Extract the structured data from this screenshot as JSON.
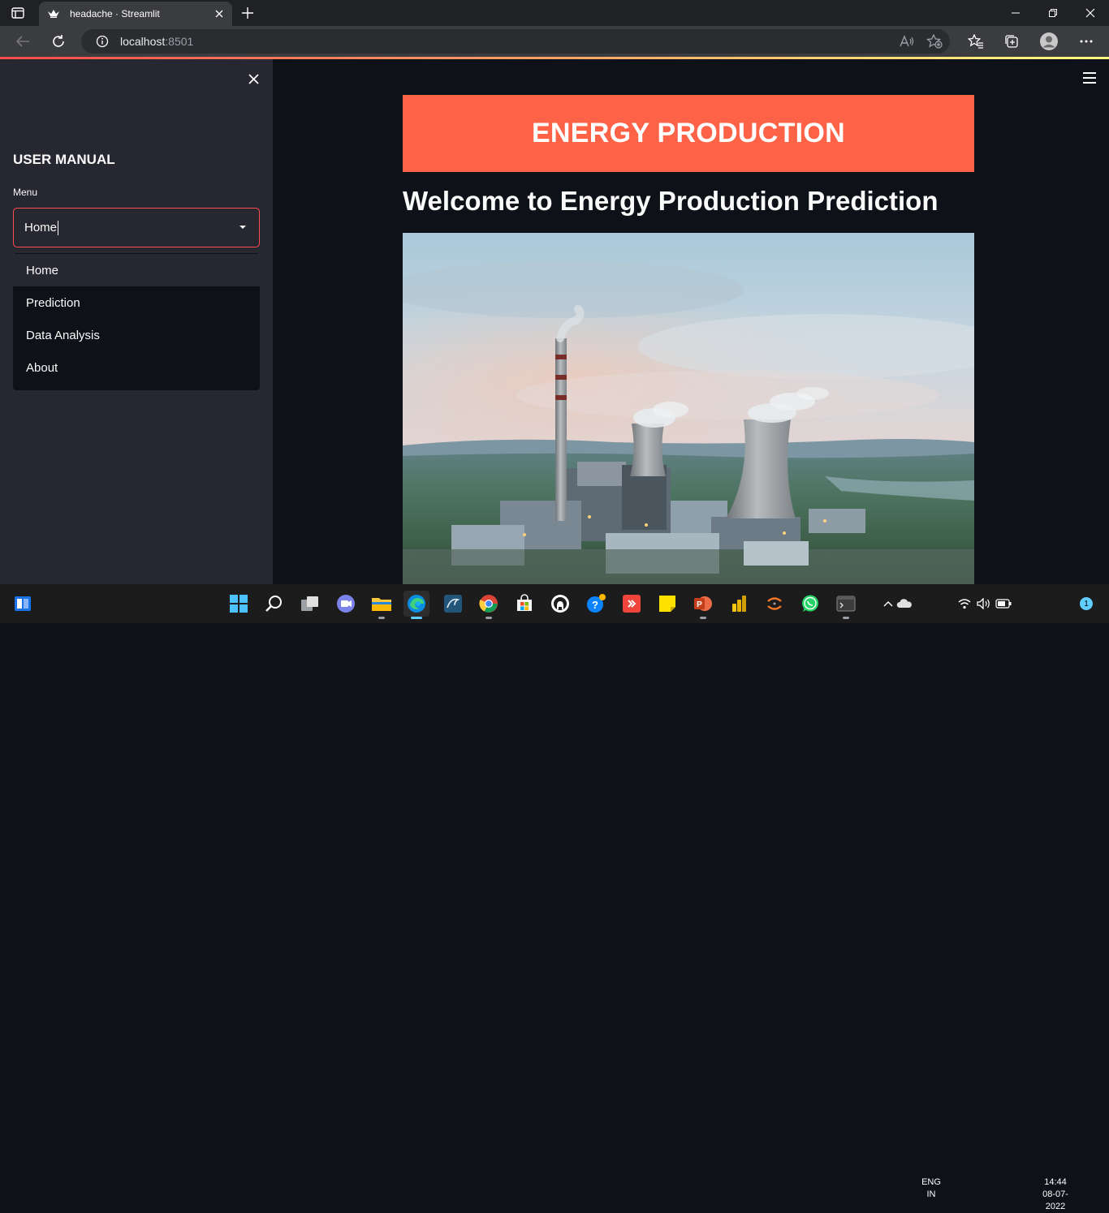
{
  "browser": {
    "tab_title": "headache · Streamlit",
    "url_host": "localhost",
    "url_port": ":8501"
  },
  "sidebar": {
    "heading": "USER MANUAL",
    "menu_label": "Menu",
    "select_value": "Home",
    "options": [
      "Home",
      "Prediction",
      "Data Analysis",
      "About"
    ]
  },
  "main": {
    "banner_title": "ENERGY PRODUCTION",
    "welcome_heading": "Welcome to Energy Production Prediction",
    "hero_image": "power-plant-photo"
  },
  "taskbar": {
    "language_line1": "ENG",
    "language_line2": "IN",
    "time": "14:44",
    "date": "08-07-2022",
    "notification_count": "1"
  },
  "colors": {
    "accent": "#ff4b4b",
    "banner": "#ff6347",
    "sidebar_bg": "#262730",
    "main_bg": "#0e1117"
  }
}
